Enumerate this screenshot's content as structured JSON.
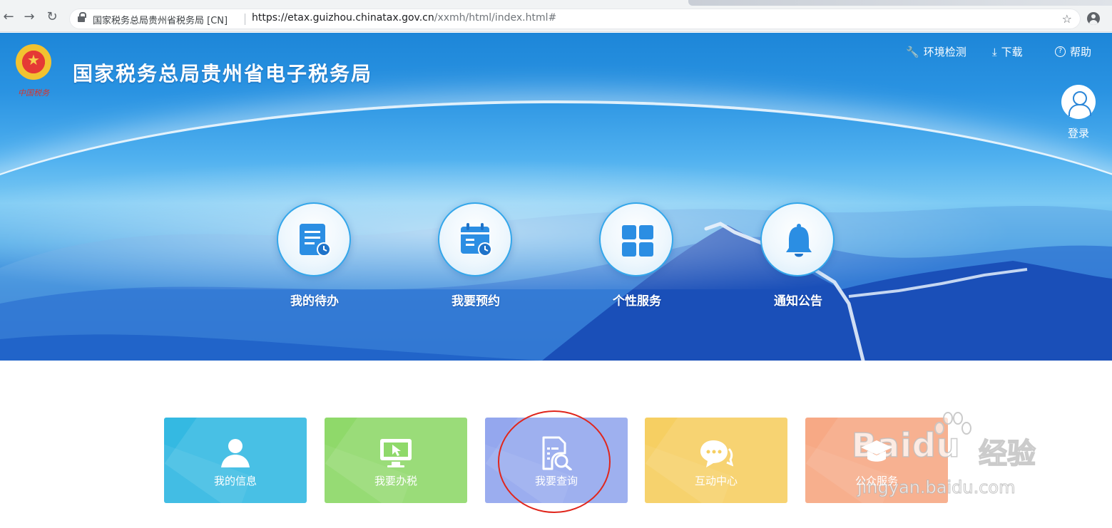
{
  "browser": {
    "site_name": "国家税务总局贵州省税务局 [CN]",
    "url_host": "https://etax.guizhou.chinatax.gov.cn",
    "url_path": "/xxmh/html/index.html#",
    "icons": [
      "back-arrow-icon",
      "forward-arrow-icon",
      "reload-icon",
      "lock-icon",
      "star-icon",
      "profile-icon"
    ]
  },
  "header": {
    "emblem_text": "中国税务",
    "title": "国家税务总局贵州省电子税务局",
    "links": {
      "env_check": "环境检测",
      "download": "下载",
      "help": "帮助"
    },
    "login": "登录"
  },
  "features": [
    {
      "label": "我的待办",
      "icon": "todo-list-icon"
    },
    {
      "label": "我要预约",
      "icon": "calendar-clock-icon"
    },
    {
      "label": "个性服务",
      "icon": "grid-icon"
    },
    {
      "label": "通知公告",
      "icon": "bell-icon"
    }
  ],
  "tiles": [
    {
      "label": "我的信息",
      "icon": "user-icon",
      "color": "#34b9e2"
    },
    {
      "label": "我要办税",
      "icon": "monitor-cursor-icon",
      "color": "#8fd96a"
    },
    {
      "label": "我要查询",
      "icon": "document-search-icon",
      "color": "#94a7ee"
    },
    {
      "label": "互动中心",
      "icon": "chat-bubbles-icon",
      "color": "#f6cf62"
    },
    {
      "label": "公众服务",
      "icon": "graduation-cap-icon",
      "color": "#f7a985"
    }
  ],
  "watermark": {
    "brand": "Baidu",
    "brand_cn": "经验",
    "url": "jingyan.baidu.com"
  },
  "colors": {
    "hero_blue": "#1d86d8",
    "annotation_red": "#e0261c"
  }
}
